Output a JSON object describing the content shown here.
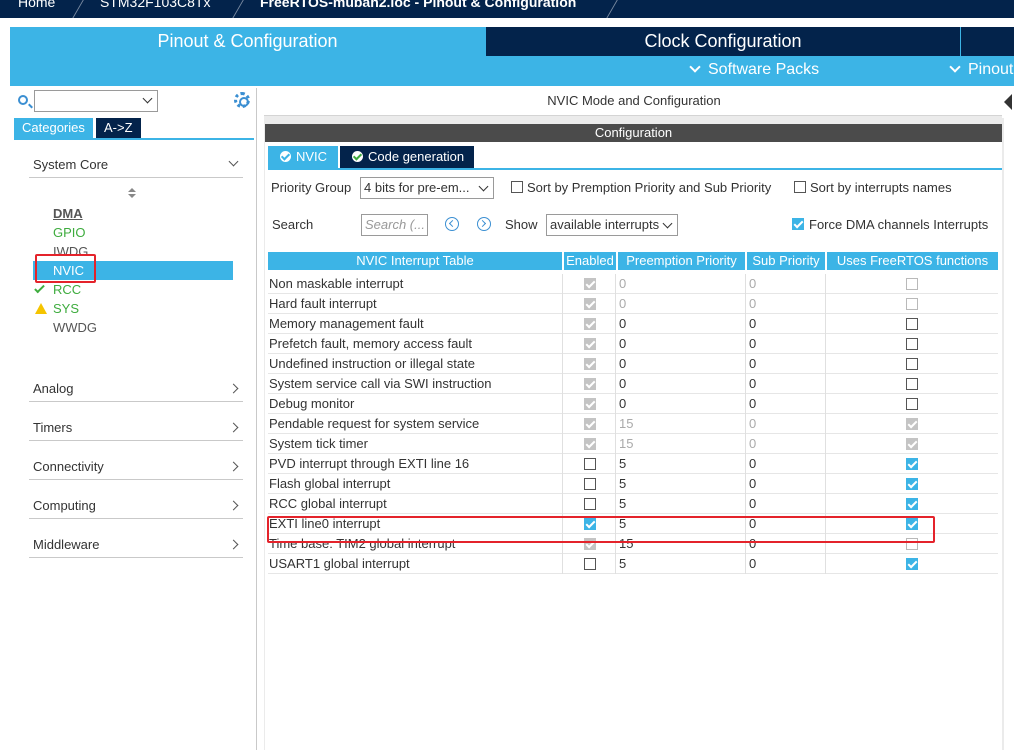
{
  "breadcrumb": [
    "Home",
    "STM32F103C8Tx",
    "FreeRTOS-muban2.ioc - Pinout & Configuration"
  ],
  "main_tabs": {
    "pinout": "Pinout & Configuration",
    "clock": "Clock Configuration",
    "software_packs": "Software Packs",
    "pinout_sub": "Pinout"
  },
  "left": {
    "tabs": [
      "Categories",
      "A->Z"
    ],
    "system_core": "System Core",
    "peripherals": [
      "DMA",
      "GPIO",
      "IWDG",
      "NVIC",
      "RCC",
      "SYS",
      "WWDG"
    ],
    "categories": [
      "Analog",
      "Timers",
      "Connectivity",
      "Computing",
      "Middleware"
    ]
  },
  "right": {
    "mode_title": "NVIC Mode and Configuration",
    "configuration": "Configuration",
    "tabs": [
      "NVIC",
      "Code generation"
    ],
    "priority_group_label": "Priority Group",
    "priority_group_value": "4 bits for pre-em...",
    "sort_premption": "Sort by Premption Priority and Sub Priority",
    "sort_names": "Sort by interrupts names",
    "search_label": "Search",
    "search_placeholder": "Search (...",
    "show_label": "Show",
    "show_value": "available interrupts",
    "force_dma": "Force DMA channels Interrupts"
  },
  "table": {
    "headers": [
      "NVIC Interrupt Table",
      "Enabled",
      "Preemption Priority",
      "Sub Priority",
      "Uses FreeRTOS functions"
    ],
    "rows": [
      {
        "name": "Non maskable interrupt",
        "enabled": true,
        "enabled_locked": true,
        "pre": "0",
        "pre_dis": true,
        "sub": "0",
        "sub_dis": true,
        "freertos": false,
        "fr_dis": true
      },
      {
        "name": "Hard fault interrupt",
        "enabled": true,
        "enabled_locked": true,
        "pre": "0",
        "pre_dis": true,
        "sub": "0",
        "sub_dis": true,
        "freertos": false,
        "fr_dis": true
      },
      {
        "name": "Memory management fault",
        "enabled": true,
        "enabled_locked": true,
        "pre": "0",
        "pre_dis": false,
        "sub": "0",
        "sub_dis": false,
        "freertos": false,
        "fr_dis": false
      },
      {
        "name": "Prefetch fault, memory access fault",
        "enabled": true,
        "enabled_locked": true,
        "pre": "0",
        "pre_dis": false,
        "sub": "0",
        "sub_dis": false,
        "freertos": false,
        "fr_dis": false
      },
      {
        "name": "Undefined instruction or illegal state",
        "enabled": true,
        "enabled_locked": true,
        "pre": "0",
        "pre_dis": false,
        "sub": "0",
        "sub_dis": false,
        "freertos": false,
        "fr_dis": false
      },
      {
        "name": "System service call via SWI instruction",
        "enabled": true,
        "enabled_locked": true,
        "pre": "0",
        "pre_dis": false,
        "sub": "0",
        "sub_dis": false,
        "freertos": false,
        "fr_dis": false
      },
      {
        "name": "Debug monitor",
        "enabled": true,
        "enabled_locked": true,
        "pre": "0",
        "pre_dis": false,
        "sub": "0",
        "sub_dis": false,
        "freertos": false,
        "fr_dis": false
      },
      {
        "name": "Pendable request for system service",
        "enabled": true,
        "enabled_locked": true,
        "pre": "15",
        "pre_dis": true,
        "sub": "0",
        "sub_dis": true,
        "freertos": true,
        "fr_dis": true
      },
      {
        "name": "System tick timer",
        "enabled": true,
        "enabled_locked": true,
        "pre": "15",
        "pre_dis": true,
        "sub": "0",
        "sub_dis": true,
        "freertos": true,
        "fr_dis": true
      },
      {
        "name": "PVD interrupt through EXTI line 16",
        "enabled": false,
        "enabled_locked": false,
        "pre": "5",
        "pre_dis": false,
        "sub": "0",
        "sub_dis": false,
        "freertos": true,
        "fr_dis": false
      },
      {
        "name": "Flash global interrupt",
        "enabled": false,
        "enabled_locked": false,
        "pre": "5",
        "pre_dis": false,
        "sub": "0",
        "sub_dis": false,
        "freertos": true,
        "fr_dis": false
      },
      {
        "name": "RCC global interrupt",
        "enabled": false,
        "enabled_locked": false,
        "pre": "5",
        "pre_dis": false,
        "sub": "0",
        "sub_dis": false,
        "freertos": true,
        "fr_dis": false
      },
      {
        "name": "EXTI line0 interrupt",
        "enabled": true,
        "enabled_locked": false,
        "pre": "5",
        "pre_dis": false,
        "sub": "0",
        "sub_dis": false,
        "freertos": true,
        "fr_dis": false
      },
      {
        "name": "Time base: TIM2 global interrupt",
        "enabled": true,
        "enabled_locked": true,
        "pre": "15",
        "pre_dis": false,
        "sub": "0",
        "sub_dis": false,
        "freertos": false,
        "fr_dis": true
      },
      {
        "name": "USART1 global interrupt",
        "enabled": false,
        "enabled_locked": false,
        "pre": "5",
        "pre_dis": false,
        "sub": "0",
        "sub_dis": false,
        "freertos": true,
        "fr_dis": false
      }
    ]
  },
  "colors": {
    "accent": "#3cb4e6",
    "dark": "#03234b",
    "ok_green": "#3eac3e",
    "warning": "#f5c400",
    "highlight_red": "#e4232b"
  }
}
